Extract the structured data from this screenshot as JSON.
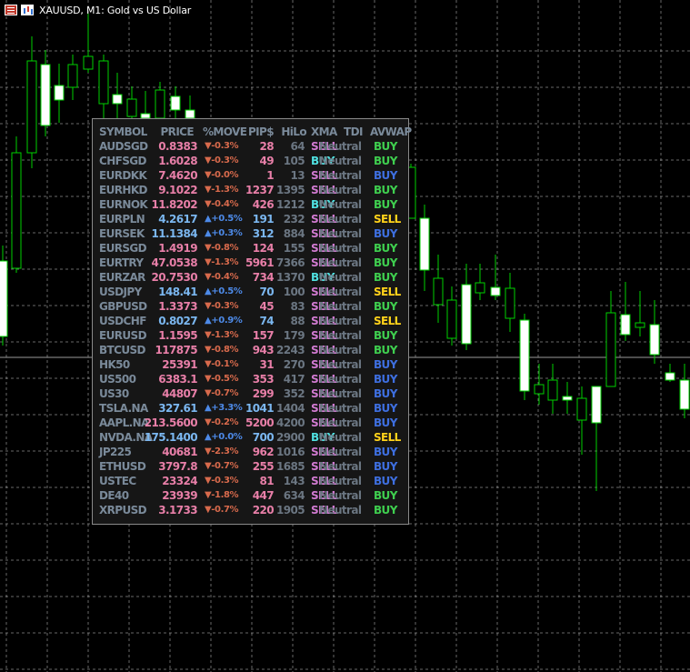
{
  "window": {
    "title": "XAUUSD, M1:  Gold vs US Dollar",
    "icons": [
      "menu-icon",
      "chart-icon"
    ]
  },
  "colors": {
    "background": "#000000",
    "grid": "#bfbfbf",
    "bull_candle": "#ffffff",
    "wick": "#00d000",
    "panel_bg": "#161616",
    "buy_green": "#3fcf4f",
    "buy_blue": "#3e6fe0",
    "sell_yellow": "#ffd21a"
  },
  "panel": {
    "headers": {
      "symbol": "SYMBOL",
      "price": "PRICE",
      "move": "%MOVE",
      "pips": "PIP$",
      "hilo": "HiLo",
      "xma": "XMA",
      "tdi": "TDI",
      "avwap": "AVWAP"
    },
    "rows": [
      {
        "symbol": "AUDSGD",
        "price": "0.8383",
        "move": "▼-0.3%",
        "dir": "down",
        "pips": "28",
        "hilo": "64",
        "xma": "SELL",
        "tdi": "Neutral",
        "avwap": "BUY",
        "sig": "g"
      },
      {
        "symbol": "CHFSGD",
        "price": "1.6028",
        "move": "▼-0.3%",
        "dir": "down",
        "pips": "49",
        "hilo": "105",
        "xma": "BUY",
        "tdi": "Neutral",
        "avwap": "BUY",
        "sig": "g",
        "xmaColor": "cyan"
      },
      {
        "symbol": "EURDKK",
        "price": "7.4620",
        "move": "▼-0.0%",
        "dir": "down",
        "pips": "1",
        "hilo": "13",
        "xma": "SELL",
        "tdi": "Neutral",
        "avwap": "BUY",
        "sig": "b"
      },
      {
        "symbol": "EURHKD",
        "price": "9.1022",
        "move": "▼-1.3%",
        "dir": "down",
        "pips": "1237",
        "hilo": "1395",
        "xma": "SELL",
        "tdi": "Neutral",
        "avwap": "BUY",
        "sig": "g"
      },
      {
        "symbol": "EURNOK",
        "price": "11.8202",
        "move": "▼-0.4%",
        "dir": "down",
        "pips": "426",
        "hilo": "1212",
        "xma": "BUY",
        "tdi": "Neutral",
        "avwap": "BUY",
        "sig": "g",
        "xmaColor": "cyan"
      },
      {
        "symbol": "EURPLN",
        "price": "4.2617",
        "move": "▲+0.5%",
        "dir": "up",
        "pips": "191",
        "hilo": "232",
        "xma": "SELL",
        "tdi": "Neutral",
        "avwap": "SELL",
        "sig": "s"
      },
      {
        "symbol": "EURSEK",
        "price": "11.1384",
        "move": "▲+0.3%",
        "dir": "up",
        "pips": "312",
        "hilo": "884",
        "xma": "SELL",
        "tdi": "Neutral",
        "avwap": "BUY",
        "sig": "b"
      },
      {
        "symbol": "EURSGD",
        "price": "1.4919",
        "move": "▼-0.8%",
        "dir": "down",
        "pips": "124",
        "hilo": "155",
        "xma": "SELL",
        "tdi": "Neutral",
        "avwap": "BUY",
        "sig": "g"
      },
      {
        "symbol": "EURTRY",
        "price": "47.0538",
        "move": "▼-1.3%",
        "dir": "down",
        "pips": "5961",
        "hilo": "7366",
        "xma": "SELL",
        "tdi": "Neutral",
        "avwap": "BUY",
        "sig": "g"
      },
      {
        "symbol": "EURZAR",
        "price": "20.7530",
        "move": "▼-0.4%",
        "dir": "down",
        "pips": "734",
        "hilo": "1370",
        "xma": "BUY",
        "tdi": "Neutral",
        "avwap": "BUY",
        "sig": "g",
        "xmaColor": "cyan"
      },
      {
        "symbol": "USDJPY",
        "price": "148.41",
        "move": "▲+0.5%",
        "dir": "up",
        "pips": "70",
        "hilo": "100",
        "xma": "SELL",
        "tdi": "Neutral",
        "avwap": "SELL",
        "sig": "s"
      },
      {
        "symbol": "GBPUSD",
        "price": "1.3373",
        "move": "▼-0.3%",
        "dir": "down",
        "pips": "45",
        "hilo": "83",
        "xma": "SELL",
        "tdi": "Neutral",
        "avwap": "BUY",
        "sig": "g"
      },
      {
        "symbol": "USDCHF",
        "price": "0.8027",
        "move": "▲+0.9%",
        "dir": "up",
        "pips": "74",
        "hilo": "88",
        "xma": "SELL",
        "tdi": "Neutral",
        "avwap": "SELL",
        "sig": "s"
      },
      {
        "symbol": "EURUSD",
        "price": "1.1595",
        "move": "▼-1.3%",
        "dir": "down",
        "pips": "157",
        "hilo": "179",
        "xma": "SELL",
        "tdi": "Neutral",
        "avwap": "BUY",
        "sig": "g"
      },
      {
        "symbol": "BTCUSD",
        "price": "117875",
        "move": "▼-0.8%",
        "dir": "down",
        "pips": "943",
        "hilo": "2243",
        "xma": "SELL",
        "tdi": "Neutral",
        "avwap": "BUY",
        "sig": "g"
      },
      {
        "symbol": "HK50",
        "price": "25391",
        "move": "▼-0.1%",
        "dir": "down",
        "pips": "31",
        "hilo": "270",
        "xma": "SELL",
        "tdi": "Neutral",
        "avwap": "BUY",
        "sig": "b"
      },
      {
        "symbol": "US500",
        "price": "6383.1",
        "move": "▼-0.5%",
        "dir": "down",
        "pips": "353",
        "hilo": "417",
        "xma": "SELL",
        "tdi": "Neutral",
        "avwap": "BUY",
        "sig": "b"
      },
      {
        "symbol": "US30",
        "price": "44807",
        "move": "▼-0.7%",
        "dir": "down",
        "pips": "299",
        "hilo": "352",
        "xma": "SELL",
        "tdi": "Neutral",
        "avwap": "BUY",
        "sig": "b"
      },
      {
        "symbol": "TSLA.NA",
        "price": "327.61",
        "move": "▲+3.3%",
        "dir": "up",
        "pips": "1041",
        "hilo": "1404",
        "xma": "SELL",
        "tdi": "Neutral",
        "avwap": "BUY",
        "sig": "b"
      },
      {
        "symbol": "AAPL.NA",
        "price": "213.5600",
        "move": "▼-0.2%",
        "dir": "down",
        "pips": "5200",
        "hilo": "4200",
        "xma": "SELL",
        "tdi": "Neutral",
        "avwap": "BUY",
        "sig": "b"
      },
      {
        "symbol": "NVDA.NA",
        "price": "175.1400",
        "move": "▲+0.0%",
        "dir": "up",
        "pips": "700",
        "hilo": "2900",
        "xma": "BUY",
        "tdi": "Neutral",
        "avwap": "SELL",
        "sig": "s",
        "xmaColor": "cyan"
      },
      {
        "symbol": "JP225",
        "price": "40681",
        "move": "▼-2.3%",
        "dir": "down",
        "pips": "962",
        "hilo": "1016",
        "xma": "SELL",
        "tdi": "Neutral",
        "avwap": "BUY",
        "sig": "b"
      },
      {
        "symbol": "ETHUSD",
        "price": "3797.8",
        "move": "▼-0.7%",
        "dir": "down",
        "pips": "255",
        "hilo": "1685",
        "xma": "SELL",
        "tdi": "Neutral",
        "avwap": "BUY",
        "sig": "b"
      },
      {
        "symbol": "USTEC",
        "price": "23324",
        "move": "▼-0.3%",
        "dir": "down",
        "pips": "81",
        "hilo": "143",
        "xma": "SELL",
        "tdi": "Neutral",
        "avwap": "BUY",
        "sig": "b"
      },
      {
        "symbol": "DE40",
        "price": "23939",
        "move": "▼-1.8%",
        "dir": "down",
        "pips": "447",
        "hilo": "634",
        "xma": "SELL",
        "tdi": "Neutral",
        "avwap": "BUY",
        "sig": "g"
      },
      {
        "symbol": "XRPUSD",
        "price": "3.1733",
        "move": "▼-0.7%",
        "dir": "down",
        "pips": "220",
        "hilo": "1905",
        "xma": "SELL",
        "tdi": "Neutral",
        "avwap": "BUY",
        "sig": "g"
      }
    ]
  }
}
